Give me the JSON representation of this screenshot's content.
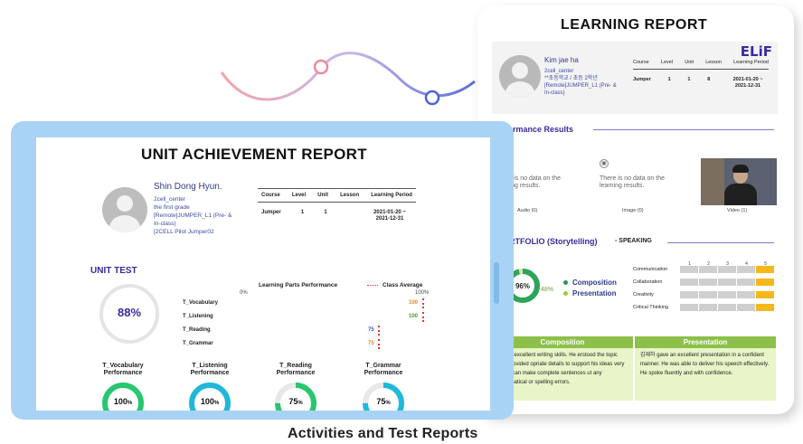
{
  "learning_report": {
    "title": "LEARNING REPORT",
    "brand": "ELiF",
    "student": {
      "name": "Kim jae ha",
      "lines": [
        "2cell_center",
        "**초등학교 / 초등 2학년",
        "[Remote]JUMPER_L1 (Pre- &",
        "In-class)"
      ]
    },
    "table": {
      "headers": [
        "Course",
        "Level",
        "Unit",
        "Lesson",
        "Learning Period"
      ],
      "row": [
        "Jumper",
        "1",
        "1",
        "8",
        "2021-01-20 ~ 2021-12-31"
      ]
    },
    "performance_results": {
      "title": "Performance Results",
      "items": [
        {
          "text": "There is no data on the learning results.",
          "caption": "Audio (0)"
        },
        {
          "text": "There is no data on the learning results.",
          "caption": "Image (0)"
        },
        {
          "caption": "Video (1)"
        }
      ]
    },
    "portfolio": {
      "title": "PORTFOLIO (Storytelling)",
      "speaking_label": "SPEAKING",
      "score": "96%",
      "secondary": "48%",
      "legend": [
        {
          "label": "Composition",
          "color": "#1f9b5b"
        },
        {
          "label": "Presentation",
          "color": "#9acb3c"
        }
      ],
      "scale": [
        "1",
        "2",
        "3",
        "4",
        "5"
      ],
      "criteria": [
        {
          "label": "Communication",
          "level": 5
        },
        {
          "label": "Collaboration",
          "level": 5
        },
        {
          "label": "Creativity",
          "level": 5
        },
        {
          "label": "Critical Thinking",
          "level": 5
        }
      ]
    },
    "comments": [
      {
        "heading": "Composition",
        "text": "하 has excellent writing skills. He erstood the topic and provided opriate details to support his ideas very ly. He can make complete sentences ut any grammatical or spelling errors."
      },
      {
        "heading": "Presentation",
        "text": "김재하 gave an excellent presentation in a confident manner. He was able to deliver his speech effectively. He spoke fluently and with confidence."
      }
    ]
  },
  "unit_report": {
    "title": "UNIT ACHIEVEMENT REPORT",
    "student": {
      "name": "Shin Dong Hyun.",
      "lines": [
        "2cell_center",
        "the first grade",
        "[Remote]JUMPER_L1 (Pre- &",
        "In-class)",
        "[2CELL  Pilot  Jumper02"
      ]
    },
    "table": {
      "headers": [
        "Course",
        "Level",
        "Unit",
        "Lesson",
        "Learning Period"
      ],
      "row": [
        "Jumper",
        "1",
        "1",
        "",
        "2021-01-20 ~ 2021-12-31"
      ]
    },
    "unit_test": {
      "title": "UNIT TEST",
      "score": "88%",
      "score_value": 88
    },
    "learning_parts": {
      "title": "Learning Parts Performance",
      "legend": "Class Average",
      "axis_min": "0%",
      "axis_max": "100%",
      "rows": [
        {
          "label": "T_Vocabulary",
          "value": "100",
          "color": "#e0882a"
        },
        {
          "label": "T_Listening",
          "value": "100",
          "color": "#4a9a2c"
        },
        {
          "label": "T_Reading",
          "value": "75",
          "color": "#3a58b8"
        },
        {
          "label": "T_Grammar",
          "value": "75",
          "color": "#e0882a"
        }
      ]
    },
    "performances": [
      {
        "title_line1": "T_Vocabulary",
        "title_line2": "Performance",
        "value": "100",
        "unit": "%",
        "color": "#28c76f",
        "fill": 1.0
      },
      {
        "title_line1": "T_Listening",
        "title_line2": "Performance",
        "value": "100",
        "unit": "%",
        "color": "#1fb8d8",
        "fill": 1.0
      },
      {
        "title_line1": "T_Reading",
        "title_line2": "Performance",
        "value": "75",
        "unit": "%",
        "color": "#28c76f",
        "fill": 0.75
      },
      {
        "title_line1": "T_Grammar",
        "title_line2": "Performance",
        "value": "75",
        "unit": "%",
        "color": "#1fb8d8",
        "fill": 0.75
      }
    ]
  },
  "caption": "Activities and Test Reports"
}
